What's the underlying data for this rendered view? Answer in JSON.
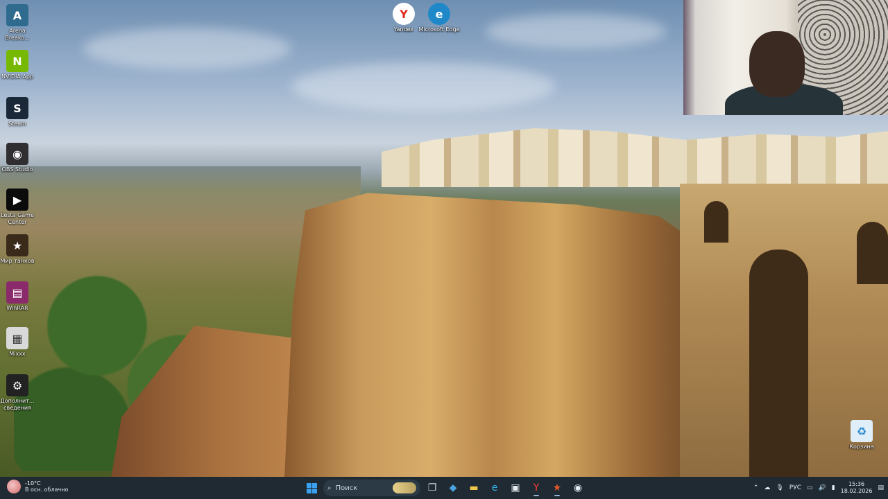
{
  "desktop": {
    "icons_left": [
      {
        "name": "arena-breakout-icon",
        "label": "Arena Breako...",
        "color": "#2f6b8f",
        "glyph": "A"
      },
      {
        "name": "nvidia-app-icon",
        "label": "NVIDIA App",
        "color": "#76b900",
        "glyph": "N"
      },
      {
        "name": "steam-icon",
        "label": "Steam",
        "color": "#1b2838",
        "glyph": "S"
      },
      {
        "name": "obs-studio-icon",
        "label": "OBS Studio",
        "color": "#302e31",
        "glyph": "◉"
      },
      {
        "name": "lesta-game-center-icon",
        "label": "Lesta Game Center",
        "color": "#0b0b0b",
        "glyph": "▶"
      },
      {
        "name": "mir-tankov-icon",
        "label": "Мир танков",
        "color": "#3a2a1a",
        "glyph": "★"
      },
      {
        "name": "winrar-icon",
        "label": "WinRAR",
        "color": "#8a2a6a",
        "glyph": "▤"
      },
      {
        "name": "mixxx-icon",
        "label": "Mixxx",
        "color": "#d9d9d9",
        "glyph": "▦"
      },
      {
        "name": "additional-info-icon",
        "label": "Дополнит... сведения",
        "color": "#222222",
        "glyph": "⚙"
      }
    ],
    "icons_top": [
      {
        "name": "yandex-icon",
        "label": "Yandex",
        "color": "#ffffff",
        "glyph": "Y"
      },
      {
        "name": "microsoft-edge-icon",
        "label": "Microsoft Edge",
        "color": "#1e88c8",
        "glyph": "e"
      }
    ],
    "recycle_bin": {
      "label": "Корзина",
      "glyph": "♻"
    }
  },
  "taskbar": {
    "weather": {
      "temp": "-10°C",
      "desc": "В осн. облачно"
    },
    "search_placeholder": "Поиск",
    "apps": [
      {
        "name": "task-view-icon",
        "glyph": "❐",
        "color": "#cfd8df"
      },
      {
        "name": "microsoft-store-alt-icon",
        "glyph": "◆",
        "color": "#4aa3df"
      },
      {
        "name": "file-explorer-icon",
        "glyph": "▬",
        "color": "#f2c94c"
      },
      {
        "name": "edge-taskbar-icon",
        "glyph": "e",
        "color": "#3ab0e8"
      },
      {
        "name": "microsoft-store-icon",
        "glyph": "▣",
        "color": "#e6edf2"
      },
      {
        "name": "yandex-taskbar-icon",
        "glyph": "Y",
        "color": "#ff3b30"
      },
      {
        "name": "lesta-taskbar-icon",
        "glyph": "★",
        "color": "#e2572c"
      },
      {
        "name": "obs-taskbar-icon",
        "glyph": "◉",
        "color": "#e6edf2"
      }
    ],
    "tray": {
      "lang": "РУС",
      "time": "15:36",
      "date": "18.02.2026"
    }
  }
}
